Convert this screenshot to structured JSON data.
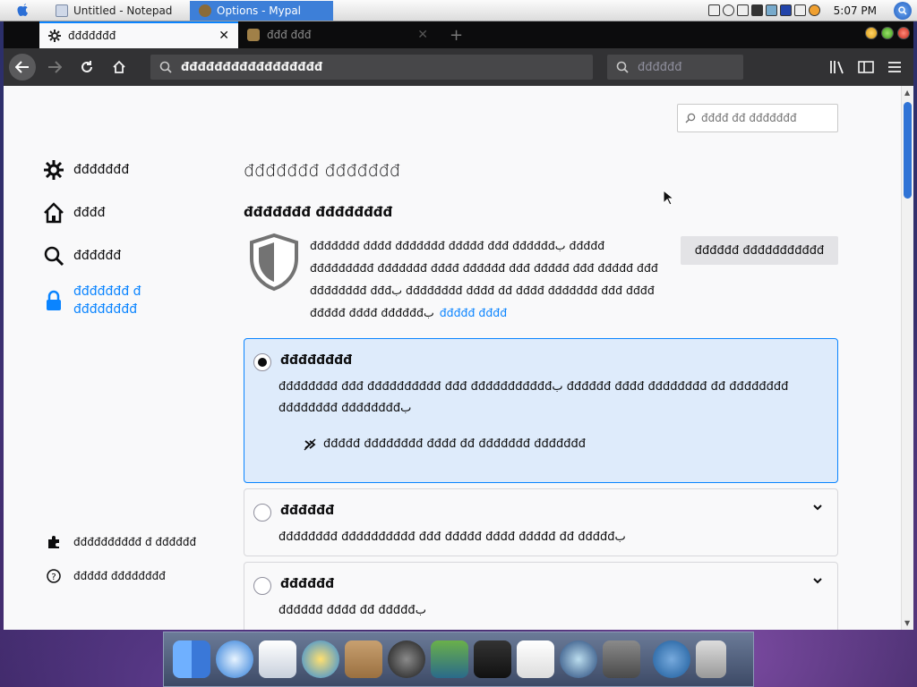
{
  "taskbar": {
    "tasks": [
      {
        "label": "Untitled - Notepad"
      },
      {
        "label": "Options - Mypal"
      }
    ],
    "clock": "5:07 PM"
  },
  "browser": {
    "tabs": [
      {
        "label": "đđđđđđđ"
      },
      {
        "label": "đđđ đđđ"
      }
    ],
    "url": "đđđđđđđđđđđđđđđđđ",
    "search_placeholder": "đđđđđđ"
  },
  "prefs": {
    "find_placeholder": "đđđđ đđ đđđđđđđ",
    "categories": [
      {
        "label": "đđđđđđđ"
      },
      {
        "label": "đđđđ"
      },
      {
        "label": "đđđđđđ"
      },
      {
        "label": "đđđđđđđ đ đđđđđđđđ"
      }
    ],
    "bottom_links": [
      {
        "label": "đđđđđđđđđđ đ đđđđđđ"
      },
      {
        "label": "đđđđđ đđđđđđđđ"
      }
    ],
    "page_title": "đđđđđđđ đđđđđđđ",
    "section_title": "đđđđđđđ đđđđđđđđ",
    "description": "đđđđđđđ đđđđ đđđđđđđ đđđđđ đđđ đđđđđđب đđđđđ đđđđđđđđđ đđđđđđđ đđđđ đđđđđđ đđđ đđđđđ đđđ đđđđđ đđđ đđđđđđđđ đđđب đđđđđđđđ đđđđ đđ đđđđ đđđđđđđ đđđ đđđđ đđđđđ đđđđ đđđđđđب",
    "learn_more": "đđđđđ đđđđ",
    "exceptions_button": "đđđđđđ đđđđđđđđđđđ",
    "cards": [
      {
        "title": "đđđđđđđđ",
        "description": "đđđđđđđđ đđđ đđđđđđđđđđ đđđ đđđđđđđđđđđب đđđđđđ đđđđ đđđđđđđđ đđ đđđđđđđđ đđđđđđđđ đđđđđđđđب",
        "sub": "đđđđđ đđđđđđđđ đđđđ đđ đđđđđđđ đđđđđđđ",
        "selected": true
      },
      {
        "title": "đđđđđđ",
        "description": "đđđđđđđđ đđđđđđđđđđ đđđ đđđđđ đđđđ đđđđđ đđ đđđđđب",
        "selected": false
      },
      {
        "title": "đđđđđđ",
        "description": "đđđđđđ đđđđ đđ đđđđđب",
        "selected": false
      }
    ]
  }
}
